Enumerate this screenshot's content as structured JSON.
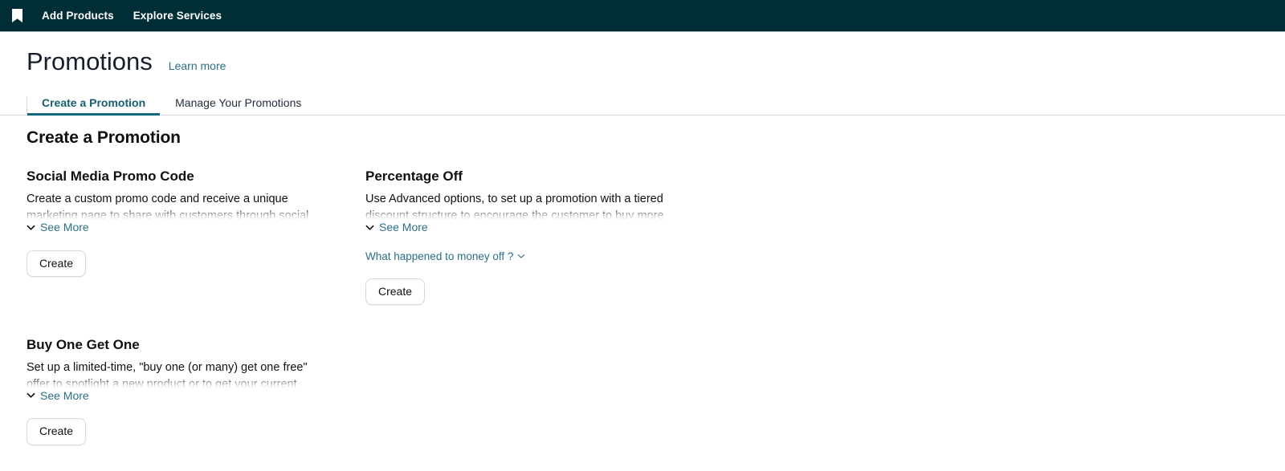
{
  "topnav": {
    "logo_icon": "bookmark-icon",
    "items": [
      {
        "label": "Add Products"
      },
      {
        "label": "Explore Services"
      }
    ],
    "background_color": "#002e36"
  },
  "header": {
    "title": "Promotions",
    "learn_more_label": "Learn more"
  },
  "tabs": [
    {
      "label": "Create a Promotion",
      "active": true
    },
    {
      "label": "Manage Your Promotions",
      "active": false
    }
  ],
  "main": {
    "section_title": "Create a Promotion",
    "see_more_label": "See More",
    "create_label": "Create",
    "cards": [
      {
        "title": "Social Media Promo Code",
        "description": "Create a custom promo code and receive a unique marketing page to share with customers through social"
      },
      {
        "title": "Percentage Off",
        "description": "Use Advanced options, to set up a promotion with a tiered discount structure to encourage the customer to buy more",
        "extra_link": "What happened to money off ?"
      },
      {
        "title": "Buy One Get One",
        "description": "Set up a limited-time, \"buy one (or many) get one free\" offer to spotlight a new product or to get your current"
      }
    ]
  },
  "colors": {
    "nav_background": "#002e36",
    "link": "#2b6f88",
    "tab_active": "#16606e",
    "tab_underline": "#13697c"
  }
}
